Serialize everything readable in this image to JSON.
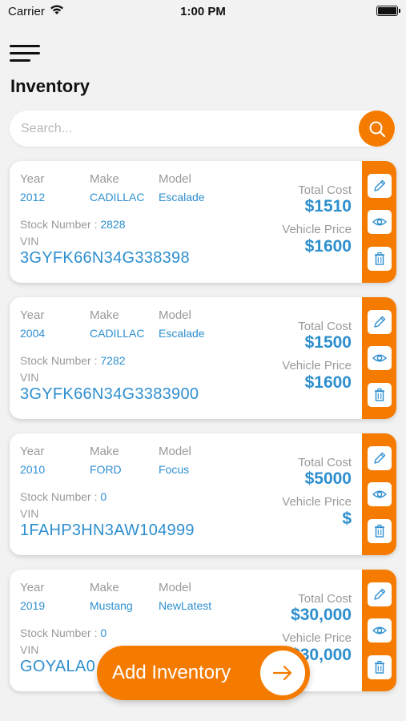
{
  "status_bar": {
    "carrier": "Carrier",
    "time": "1:00 PM"
  },
  "header": {
    "title": "Inventory"
  },
  "search": {
    "placeholder": "Search..."
  },
  "labels": {
    "year": "Year",
    "make": "Make",
    "model": "Model",
    "stock_number": "Stock Number : ",
    "vin": "VIN",
    "total_cost": "Total Cost",
    "vehicle_price": "Vehicle Price"
  },
  "inventory": [
    {
      "year": "2012",
      "make": "CADILLAC",
      "model": "Escalade",
      "stock_number": "2828",
      "vin": "3GYFK66N34G338398",
      "total_cost": "$1510",
      "vehicle_price": "$1600"
    },
    {
      "year": "2004",
      "make": "CADILLAC",
      "model": "Escalade",
      "stock_number": "7282",
      "vin": "3GYFK66N34G3383900",
      "total_cost": "$1500",
      "vehicle_price": "$1600"
    },
    {
      "year": "2010",
      "make": "FORD",
      "model": "Focus",
      "stock_number": "0",
      "vin": "1FAHP3HN3AW104999",
      "total_cost": "$5000",
      "vehicle_price": "$"
    },
    {
      "year": "2019",
      "make": "Mustang",
      "model": "NewLatest",
      "stock_number": "0",
      "vin": "GOYALA0",
      "total_cost": "$30,000",
      "vehicle_price": "$30,000"
    }
  ],
  "fab": {
    "label": "Add Inventory"
  },
  "colors": {
    "accent": "#f47b00",
    "value_blue": "#2e8fcf",
    "label_gray": "#9a9a9a",
    "background": "#f2f2f2"
  },
  "icons": {
    "menu": "hamburger-icon",
    "search": "search-icon",
    "edit": "pencil-icon",
    "view": "eye-icon",
    "delete": "trash-icon",
    "add": "arrow-right-icon"
  }
}
